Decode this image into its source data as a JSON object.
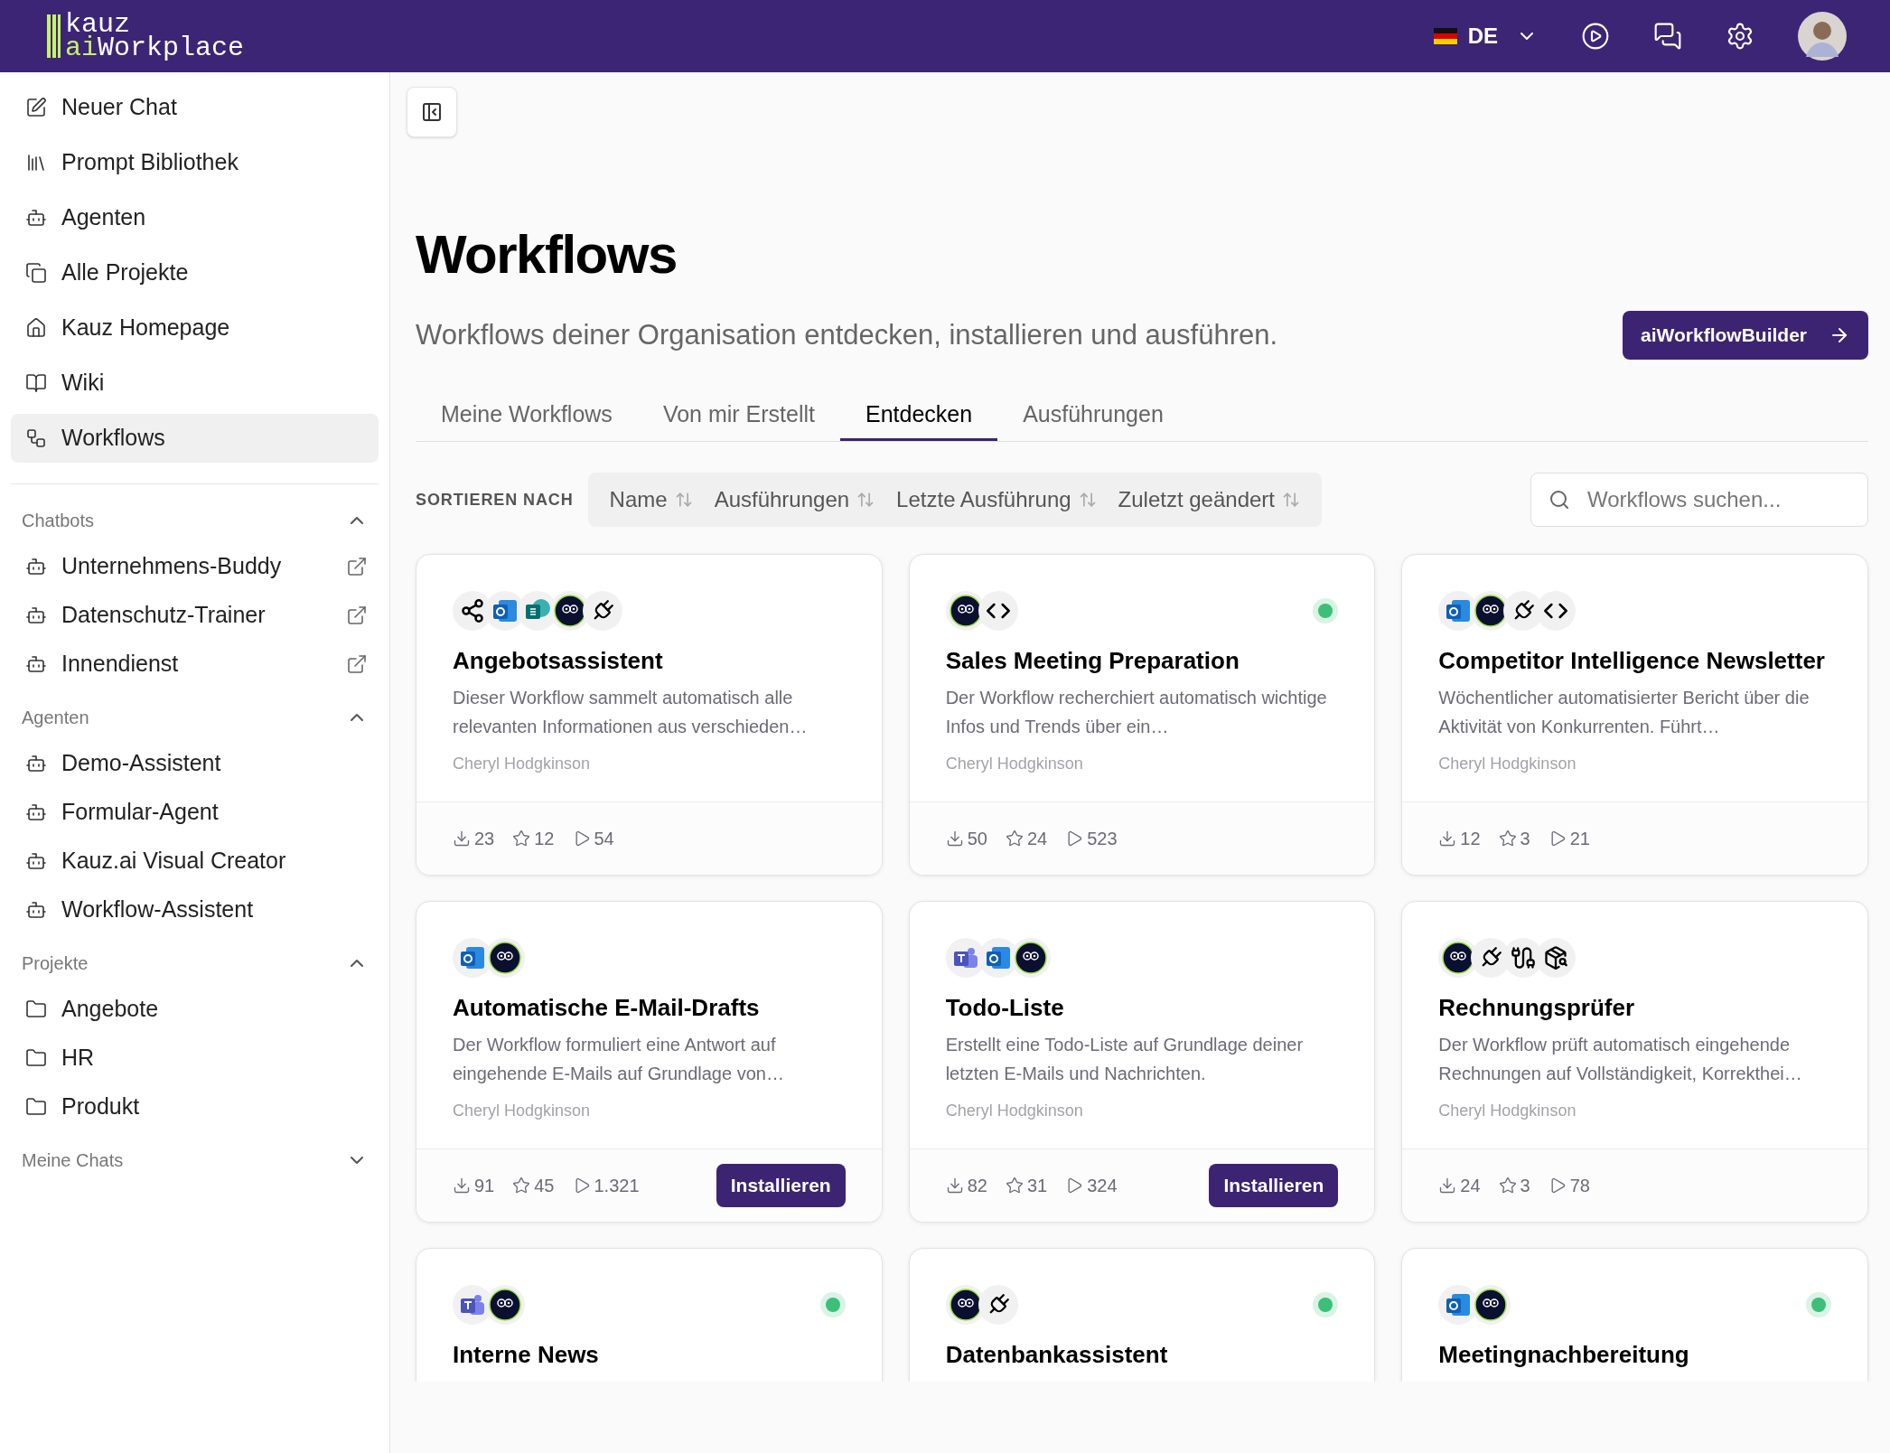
{
  "header": {
    "logo": {
      "top": "kauz",
      "accent": "ai",
      "bottom": "Workplace"
    },
    "language": "DE"
  },
  "sidebar": {
    "items": [
      {
        "label": "Neuer Chat",
        "kind": "edit",
        "selected": false
      },
      {
        "label": "Prompt Bibliothek",
        "kind": "library",
        "selected": false
      },
      {
        "label": "Agenten",
        "kind": "bot",
        "selected": false
      },
      {
        "label": "Alle Projekte",
        "kind": "folders",
        "selected": false
      },
      {
        "label": "Kauz Homepage",
        "kind": "home",
        "selected": false
      },
      {
        "label": "Wiki",
        "kind": "book",
        "selected": false
      },
      {
        "label": "Workflows",
        "kind": "workflow",
        "selected": true
      }
    ],
    "sections": [
      {
        "title": "Chatbots",
        "expanded": true,
        "items": [
          {
            "label": "Unternehmens-Buddy",
            "kind": "bot",
            "external": true
          },
          {
            "label": "Datenschutz-Trainer",
            "kind": "bot",
            "external": true
          },
          {
            "label": "Innendienst",
            "kind": "bot",
            "external": true
          }
        ]
      },
      {
        "title": "Agenten",
        "expanded": true,
        "items": [
          {
            "label": "Demo-Assistent",
            "kind": "bot",
            "external": false
          },
          {
            "label": "Formular-Agent",
            "kind": "bot",
            "external": false
          },
          {
            "label": "Kauz.ai Visual Creator",
            "kind": "bot",
            "external": false
          },
          {
            "label": "Workflow-Assistent",
            "kind": "bot",
            "external": false
          }
        ]
      },
      {
        "title": "Projekte",
        "expanded": true,
        "items": [
          {
            "label": "Angebote",
            "kind": "folder",
            "external": false
          },
          {
            "label": "HR",
            "kind": "folder",
            "external": false
          },
          {
            "label": "Produkt",
            "kind": "folder",
            "external": false
          }
        ]
      },
      {
        "title": "Meine Chats",
        "expanded": false
      }
    ]
  },
  "page": {
    "title": "Workflows",
    "subtitle": "Workflows deiner Organisation entdecken, installieren und ausführen.",
    "builder_button": "aiWorkflowBuilder",
    "tabs": [
      {
        "label": "Meine Workflows",
        "selected": false
      },
      {
        "label": "Von mir Erstellt",
        "selected": false
      },
      {
        "label": "Entdecken",
        "selected": true
      },
      {
        "label": "Ausführungen",
        "selected": false
      }
    ],
    "sort": {
      "label": "SORTIEREN NACH",
      "options": [
        "Name",
        "Ausführungen",
        "Letzte Ausführung",
        "Zuletzt geändert"
      ]
    },
    "search": {
      "placeholder": "Workflows suchen..."
    }
  },
  "workflows": [
    {
      "icons": [
        {
          "kind": "network"
        },
        {
          "kind": "outlook"
        },
        {
          "kind": "sharepoint"
        },
        {
          "kind": "owl"
        },
        {
          "kind": "plug"
        }
      ],
      "title": "Angebotsassistent",
      "description": "Dieser Workflow sammelt automatisch alle relevanten Informationen aus verschieden…",
      "author": "Cheryl Hodgkinson",
      "installs": "23",
      "stars": "12",
      "runs": "54",
      "active": false
    },
    {
      "icons": [
        {
          "kind": "owl"
        },
        {
          "kind": "code"
        }
      ],
      "title": "Sales Meeting Preparation",
      "description": "Der Workflow recherchiert automatisch wichtige Infos und Trends über ein…",
      "author": "Cheryl Hodgkinson",
      "installs": "50",
      "stars": "24",
      "runs": "523",
      "active": true
    },
    {
      "icons": [
        {
          "kind": "outlook"
        },
        {
          "kind": "owl"
        },
        {
          "kind": "plug"
        },
        {
          "kind": "code"
        }
      ],
      "title": "Competitor Intelligence Newsletter",
      "description": "Wöchentlicher automatisierter Bericht über die Aktivität von Konkurrenten. Führt…",
      "author": "Cheryl Hodgkinson",
      "installs": "12",
      "stars": "3",
      "runs": "21",
      "active": false
    },
    {
      "icons": [
        {
          "kind": "outlook"
        },
        {
          "kind": "owl"
        }
      ],
      "title": "Automatische E-Mail-Drafts",
      "description": "Der Workflow formuliert eine Antwort auf eingehende E-Mails auf Grundlage von…",
      "author": "Cheryl Hodgkinson",
      "installs": "91",
      "stars": "45",
      "runs": "1.321",
      "active": false,
      "install_button": "Installieren"
    },
    {
      "icons": [
        {
          "kind": "teams"
        },
        {
          "kind": "outlook"
        },
        {
          "kind": "owl"
        }
      ],
      "title": "Todo-Liste",
      "description": "Erstellt eine Todo-Liste auf Grundlage deiner letzten E-Mails und Nachrichten.",
      "author": "Cheryl Hodgkinson",
      "installs": "82",
      "stars": "31",
      "runs": "324",
      "active": false,
      "install_button": "Installieren"
    },
    {
      "icons": [
        {
          "kind": "owl"
        },
        {
          "kind": "plug"
        },
        {
          "kind": "branch"
        },
        {
          "kind": "package"
        }
      ],
      "title": "Rechnungsprüfer",
      "description": "Der Workflow prüft automatisch eingehende Rechnungen auf Vollständigkeit, Korrekthei…",
      "author": "Cheryl Hodgkinson",
      "installs": "24",
      "stars": "3",
      "runs": "78",
      "active": false
    },
    {
      "icons": [
        {
          "kind": "teams"
        },
        {
          "kind": "owl"
        }
      ],
      "title": "Interne News",
      "active": true
    },
    {
      "icons": [
        {
          "kind": "owl"
        },
        {
          "kind": "plug"
        }
      ],
      "title": "Datenbankassistent",
      "active": true
    },
    {
      "icons": [
        {
          "kind": "outlook"
        },
        {
          "kind": "owl"
        }
      ],
      "title": "Meetingnachbereitung",
      "active": true
    }
  ]
}
